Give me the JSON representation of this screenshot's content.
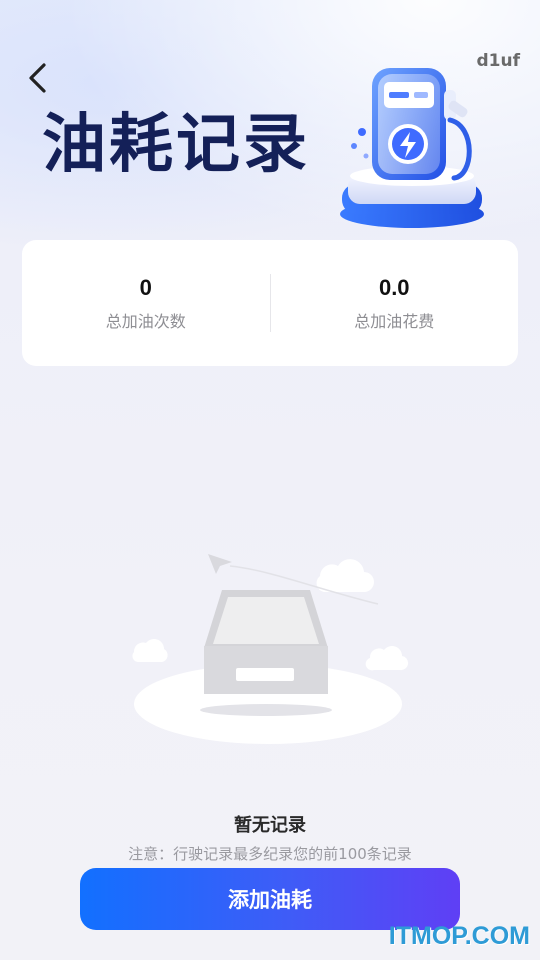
{
  "header": {
    "title": "油耗记录",
    "user_tag": "d1uf",
    "back_icon": "chevron-left-icon"
  },
  "stats": [
    {
      "value": "0",
      "label": "总加油次数"
    },
    {
      "value": "0.0",
      "label": "总加油花费"
    }
  ],
  "empty_state": {
    "title": "暂无记录",
    "note": "注意：行驶记录最多纪录您的前100条记录",
    "illustration": "empty-box-icon"
  },
  "actions": {
    "add_label": "添加油耗"
  },
  "watermark": "ITMOP.COM",
  "colors": {
    "title": "#142058",
    "accent_start": "#1270ff",
    "accent_end": "#5f3ff5",
    "background": "#f1f1f8"
  }
}
